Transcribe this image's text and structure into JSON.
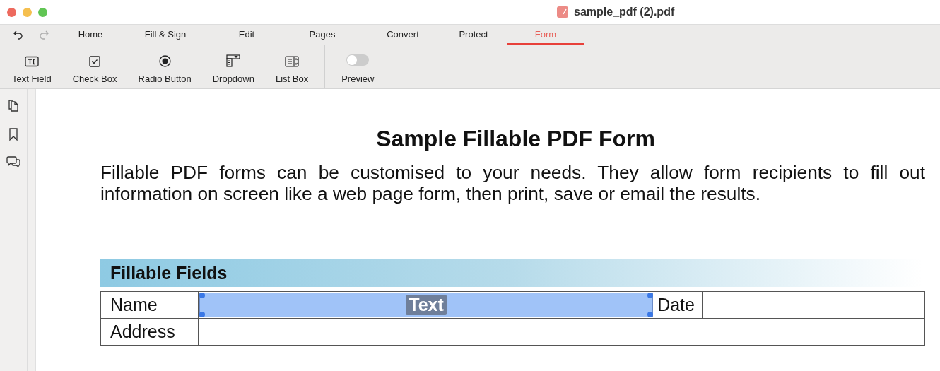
{
  "window": {
    "title": "sample_pdf (2).pdf"
  },
  "tabs": [
    {
      "label": "Home",
      "selected": false
    },
    {
      "label": "Fill & Sign",
      "selected": false
    },
    {
      "label": "Edit",
      "selected": false
    },
    {
      "label": "Pages",
      "selected": false
    },
    {
      "label": "Convert",
      "selected": false
    },
    {
      "label": "Protect",
      "selected": false
    },
    {
      "label": "Form",
      "selected": true
    }
  ],
  "tools": [
    {
      "kind": "textfield",
      "label": "Text Field"
    },
    {
      "kind": "checkbox",
      "label": "Check Box"
    },
    {
      "kind": "radio",
      "label": "Radio Button"
    },
    {
      "kind": "dropdown",
      "label": "Dropdown"
    },
    {
      "kind": "listbox",
      "label": "List Box"
    }
  ],
  "preview": {
    "label": "Preview",
    "on": false
  },
  "document": {
    "title": "Sample Fillable PDF Form",
    "intro": "Fillable PDF forms can be customised to your needs. They allow form recipients to fill out information on screen like a web page form, then print, save or email the results.",
    "section": "Fillable Fields",
    "rows": [
      {
        "cells": [
          {
            "kind": "label",
            "text": "Name"
          },
          {
            "kind": "field",
            "tag": "Text",
            "selected": true
          },
          {
            "kind": "label",
            "text": "Date"
          },
          {
            "kind": "field",
            "selected": false
          }
        ]
      },
      {
        "cells": [
          {
            "kind": "label",
            "text": "Address"
          },
          {
            "kind": "field",
            "selected": false
          }
        ]
      }
    ]
  }
}
